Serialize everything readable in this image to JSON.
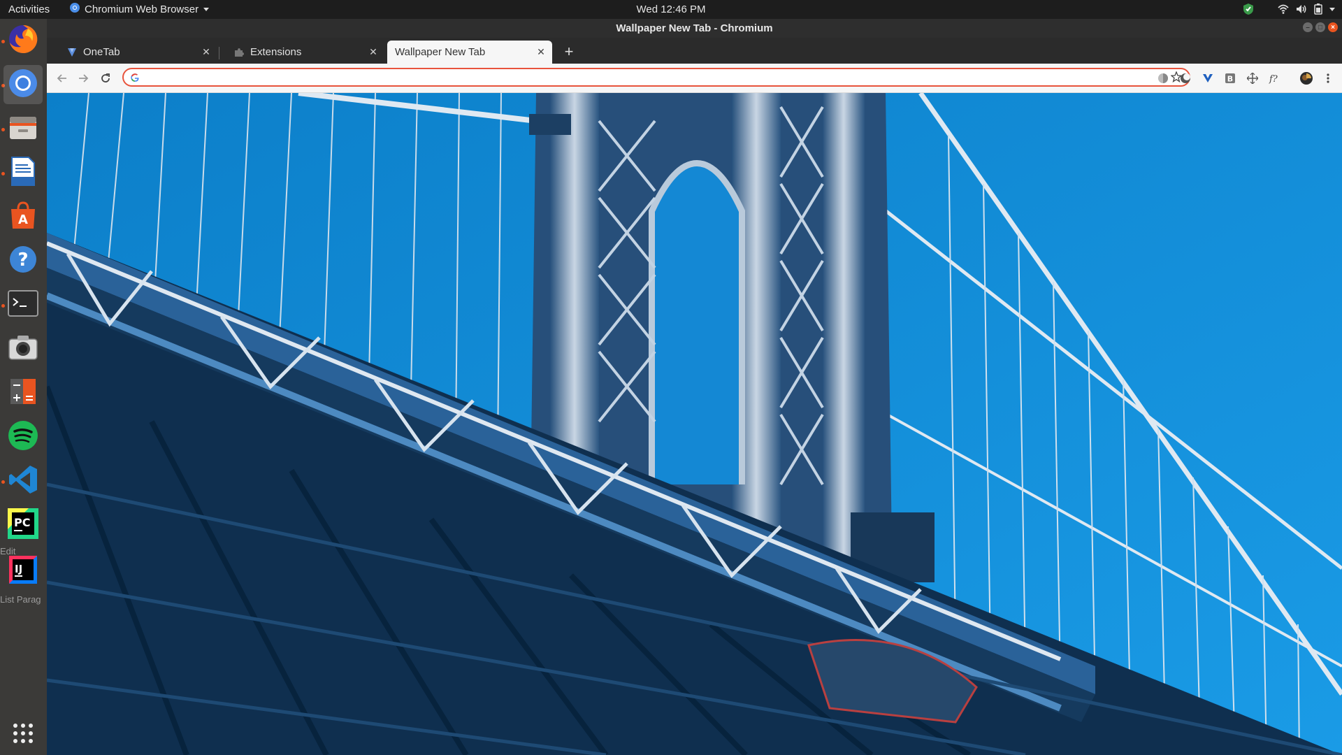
{
  "topbar": {
    "activities": "Activities",
    "app_menu": "Chromium Web Browser",
    "clock": "Wed 12:46 PM"
  },
  "dock": {
    "items": [
      {
        "name": "firefox",
        "icon": "firefox-icon"
      },
      {
        "name": "chromium",
        "icon": "chromium-icon"
      },
      {
        "name": "files",
        "icon": "files-icon"
      },
      {
        "name": "writer",
        "icon": "libreoffice-writer-icon"
      },
      {
        "name": "software",
        "icon": "ubuntu-software-icon"
      },
      {
        "name": "help",
        "icon": "help-icon"
      },
      {
        "name": "terminal",
        "icon": "terminal-icon"
      },
      {
        "name": "screenshot",
        "icon": "camera-icon"
      },
      {
        "name": "calculator",
        "icon": "calculator-icon"
      },
      {
        "name": "spotify",
        "icon": "spotify-icon"
      },
      {
        "name": "vscode",
        "icon": "vscode-icon"
      },
      {
        "name": "pycharm",
        "icon": "pycharm-icon"
      },
      {
        "name": "intellij",
        "icon": "intellij-icon"
      }
    ],
    "ghost_text_1": "Edit",
    "ghost_text_2": "List Parag",
    "show_apps": "show-applications-icon"
  },
  "window": {
    "title": "Wallpaper New Tab - Chromium"
  },
  "tabs": [
    {
      "label": "OneTab",
      "icon": "onetab-icon"
    },
    {
      "label": "Extensions",
      "icon": "puzzle-icon"
    },
    {
      "label": "Wallpaper New Tab",
      "active": true
    }
  ],
  "omnibox": {
    "value": "",
    "placeholder": ""
  },
  "colors": {
    "accent": "#e8533c",
    "sky": "#1e93d6",
    "steel": "#1f4f80"
  }
}
